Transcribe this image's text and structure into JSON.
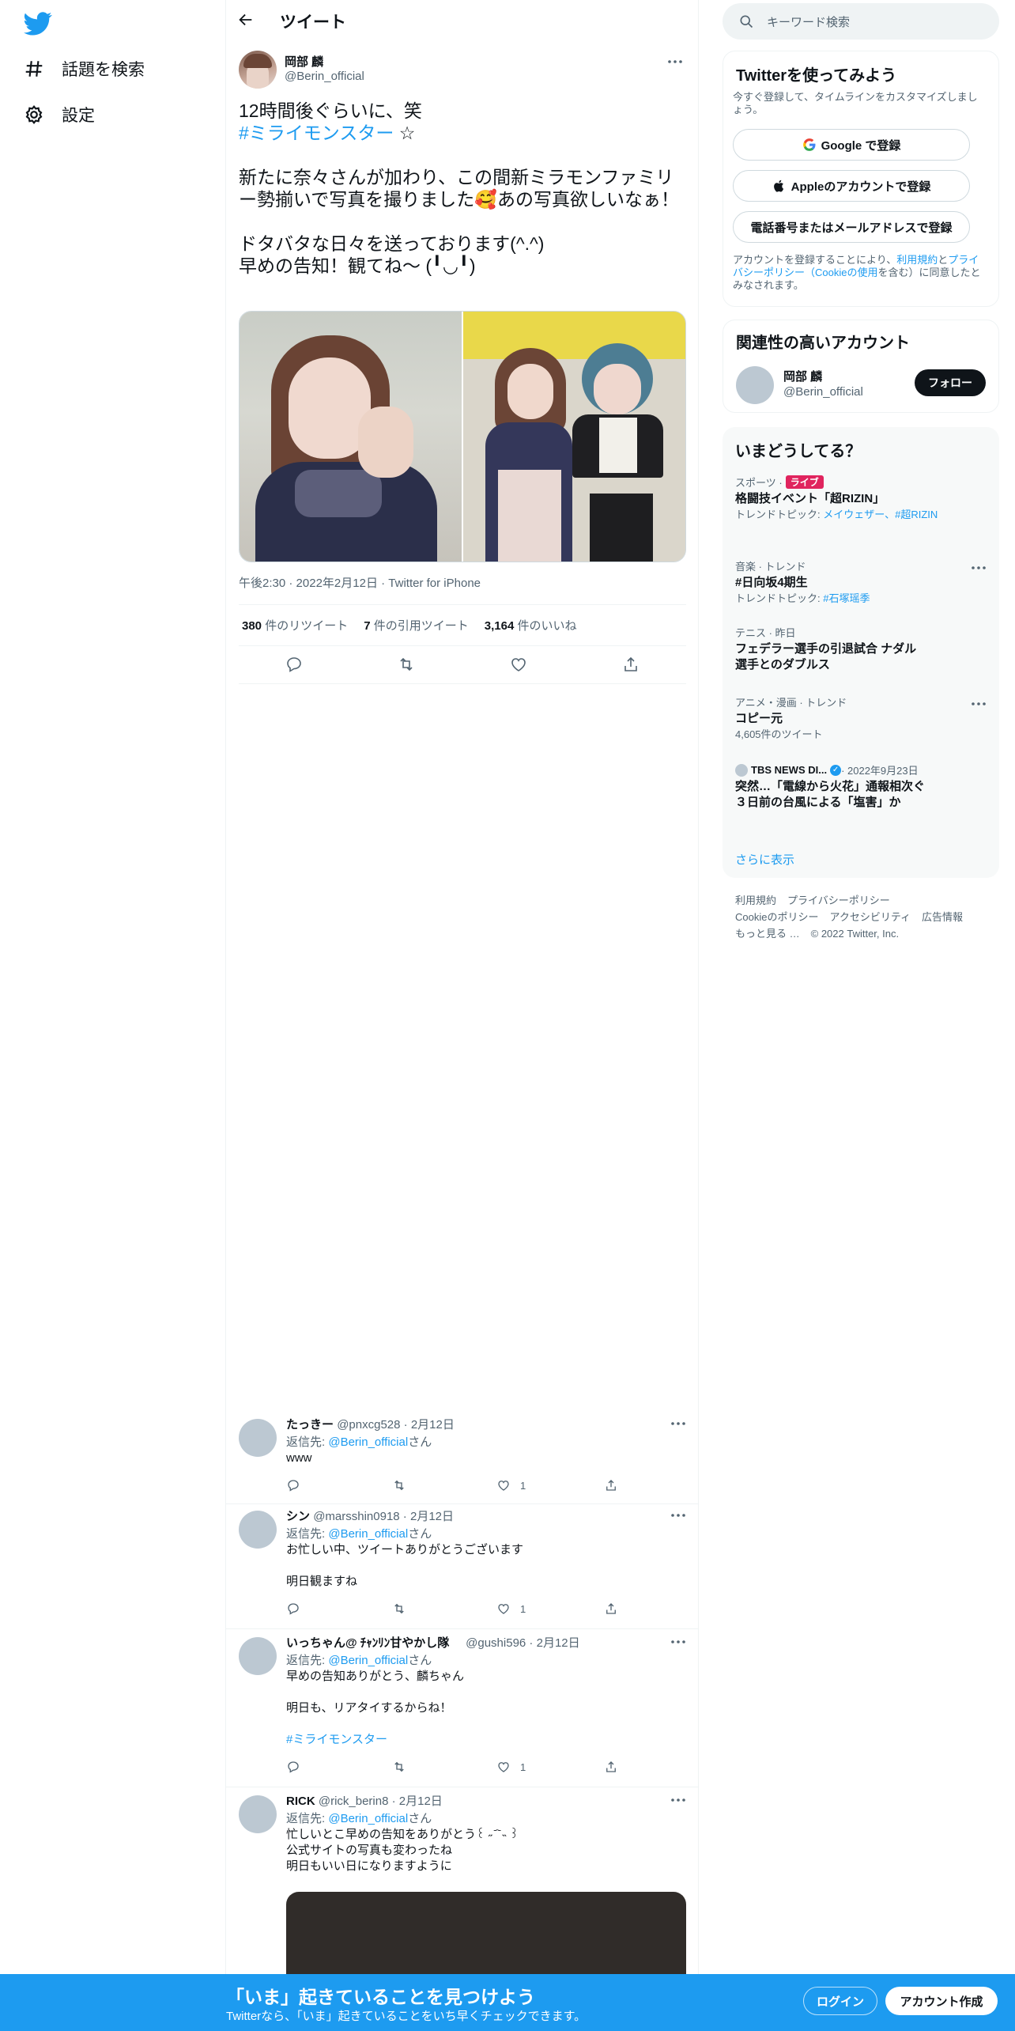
{
  "nav": {
    "explore_label": "話題を検索",
    "settings_label": "設定"
  },
  "header": {
    "title": "ツイート"
  },
  "tweet": {
    "author_name": "岡部 麟",
    "author_handle": "@Berin_official",
    "text_line1": "12時間後ぐらいに、笑",
    "hashtag": "#ミライモンスター",
    "hashtag_suffix": " ☆",
    "text_body": "新たに奈々さんが加わり、この間新ミラモンファミリー勢揃いで写真を撮りました🥰あの写真欲しいなぁ！\n\nドタバタな日々を送っております(^.^)\n早めの告知！観てね〜 (╹◡╹)",
    "time": "午後2:30",
    "date": "2022年2月12日",
    "source": "Twitter for iPhone",
    "retweets_count": "380",
    "retweets_label": "件のリツイート",
    "quotes_count": "7",
    "quotes_label": "件の引用ツイート",
    "likes_count": "3,164",
    "likes_label": "件のいいね"
  },
  "replies": [
    {
      "name": "たっきー",
      "handle": "@pnxcg528",
      "date": "2月12日",
      "reply_to_prefix": "返信先: ",
      "reply_to": "@Berin_official",
      "reply_to_suffix": "さん",
      "text": "www",
      "likes": "1"
    },
    {
      "name": "シン",
      "handle": "@marsshin0918",
      "date": "2月12日",
      "reply_to_prefix": "返信先: ",
      "reply_to": "@Berin_official",
      "reply_to_suffix": "さん",
      "text": "お忙しい中、ツイートありがとうございます\n\n明日観ますね",
      "likes": "1"
    },
    {
      "name": "いっちゃん@ ﾁｬﾝﾘﾝ甘やかし隊",
      "handle": "@gushi596",
      "date": "2月12日",
      "reply_to_prefix": "返信先: ",
      "reply_to": "@Berin_official",
      "reply_to_suffix": "さん",
      "text": "早めの告知ありがとう、麟ちゃん\n\n明日も、リアタイするからね！",
      "hashtag": "#ミライモンスター",
      "likes": "1"
    },
    {
      "name": "RICK",
      "handle": "@rick_berin8",
      "date": "2月12日",
      "reply_to_prefix": "返信先: ",
      "reply_to": "@Berin_official",
      "reply_to_suffix": "さん",
      "text": "忙しいとこ早めの告知をありがとう꒰ ˶ ᷄ ᷅ ˵ ꒱\n公式サイトの写真も変わったね\n明日もいい日になりますように"
    }
  ],
  "right": {
    "search_placeholder": "キーワード検索",
    "signup": {
      "title": "Twitterを使ってみよう",
      "desc": "今すぐ登録して、タイムラインをカスタマイズしましょう。",
      "google": "Google で登録",
      "apple": "Appleのアカウントで登録",
      "phone": "電話番号またはメールアドレスで登録",
      "terms_1": "アカウントを登録することにより、",
      "terms_link1": "利用規約",
      "terms_2": "と",
      "terms_link2": "プライバシーポリシー（Cookieの使用",
      "terms_3": "を含む）に同意したとみなされます。"
    },
    "related": {
      "title": "関連性の高いアカウント",
      "name": "岡部 麟",
      "handle": "@Berin_official",
      "follow": "フォロー"
    },
    "trends": {
      "title": "いまどうしてる？",
      "items": [
        {
          "category": "スポーツ · ",
          "live": "ライブ",
          "title": "格闘技イベント「超RIZIN」",
          "sub_prefix": "トレンドトピック: ",
          "sub_links": "メイウェザー、#超RIZIN"
        },
        {
          "category": "音楽 · トレンド",
          "title": "#日向坂4期生",
          "sub_prefix": "トレンドトピック: ",
          "sub_links": "#石塚瑶季"
        },
        {
          "category": "テニス · 昨日",
          "title": "フェデラー選手の引退試合 ナダル選手とのダブルス"
        },
        {
          "category": "アニメ・漫画 · トレンド",
          "title": "コピー元",
          "sub": "4,605件のツイート"
        },
        {
          "category_source": "TBS NEWS DI...",
          "category_date": " · 2022年9月23日",
          "title": "突然…「電線から火花」通報相次ぐ　３日前の台風による「塩害」か"
        }
      ],
      "show_more": "さらに表示"
    },
    "footer": {
      "terms": "利用規約",
      "privacy": "プライバシーポリシー",
      "cookies": "Cookieのポリシー",
      "accessibility": "アクセシビリティ",
      "ads": "広告情報",
      "more": "もっと見る …",
      "copyright": "© 2022 Twitter, Inc."
    }
  },
  "banner": {
    "title": "「いま」起きていることを見つけよう",
    "subtitle": "Twitterなら、「いま」起きていることをいち早くチェックできます。",
    "login": "ログイン",
    "signup": "アカウント作成"
  },
  "colors": {
    "accent": "#1d9bf0",
    "text": "#0f1419",
    "muted": "#536471",
    "live": "#e0245e"
  }
}
